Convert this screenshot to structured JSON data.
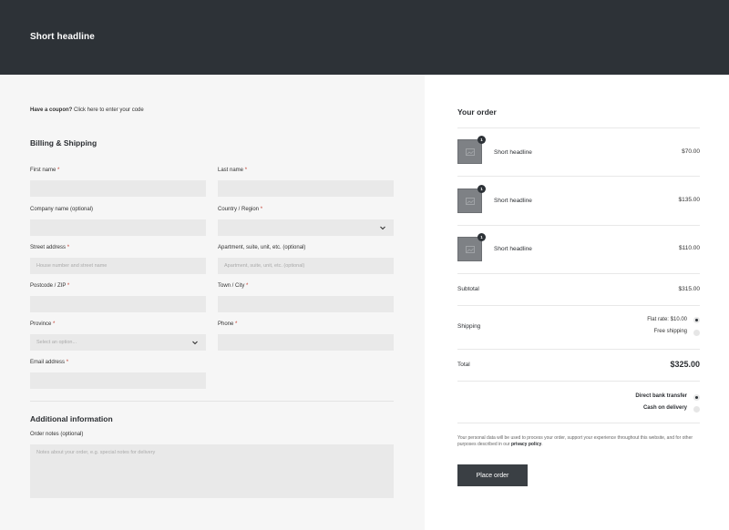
{
  "header": {
    "title": "Short headline"
  },
  "coupon": {
    "prompt": "Have a coupon?",
    "link": "Click here to enter your code"
  },
  "billing": {
    "title": "Billing & Shipping",
    "first_name": "First name",
    "last_name": "Last name",
    "company": "Company name (optional)",
    "country": "Country / Region",
    "street": "Street address",
    "street_placeholder": "House number and street name",
    "apartment": "Apartment, suite, unit, etc. (optional)",
    "apartment_placeholder": "Apartment, suite, unit, etc. (optional)",
    "postcode": "Postcode / ZIP",
    "town": "Town / City",
    "province": "Province",
    "province_placeholder": "Select an option...",
    "phone": "Phone",
    "email": "Email address",
    "required_mark": "*"
  },
  "additional": {
    "title": "Additional information",
    "notes_label": "Order notes (optional)",
    "notes_placeholder": "Notes about your order, e.g. special notes for delivery"
  },
  "order": {
    "title": "Your order",
    "items": [
      {
        "name": "Short headline",
        "price": "$70.00",
        "qty": "1"
      },
      {
        "name": "Short headline",
        "price": "$135.00",
        "qty": "1"
      },
      {
        "name": "Short headline",
        "price": "$110.00",
        "qty": "1"
      }
    ],
    "subtotal_label": "Subtotal",
    "subtotal_value": "$315.00",
    "shipping_label": "Shipping",
    "shipping_options": [
      "Flat rate: $10.00",
      "Free shipping"
    ],
    "total_label": "Total",
    "total_value": "$325.00",
    "payment_options": [
      "Direct bank transfer",
      "Cash on delivery"
    ],
    "privacy_text": "Your personal data will be used to process your order, support your experience throughout this website, and for other purposes described in our",
    "privacy_link": "privacy policy",
    "place_order": "Place order"
  }
}
